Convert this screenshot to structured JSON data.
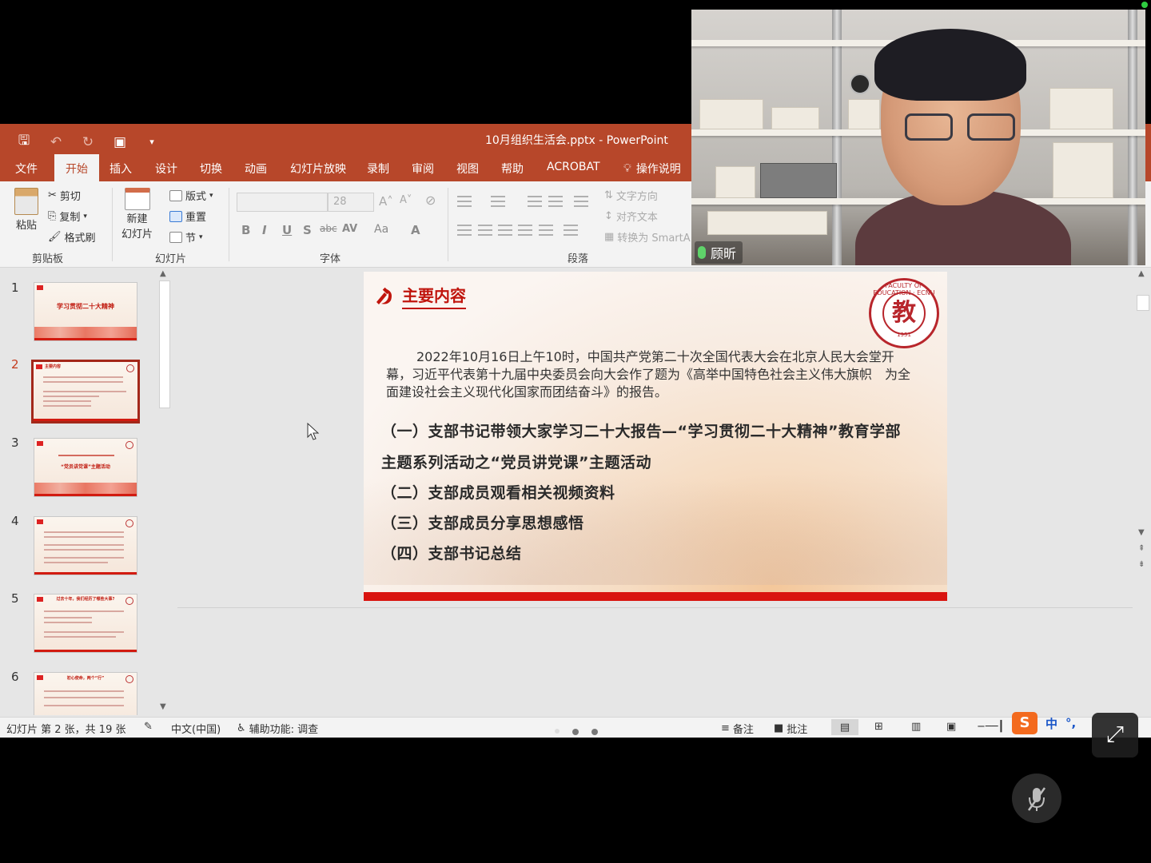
{
  "window": {
    "title": "10月组织生活会.pptx  -  PowerPoint"
  },
  "tabs": [
    "文件",
    "开始",
    "插入",
    "设计",
    "切换",
    "动画",
    "幻灯片放映",
    "录制",
    "审阅",
    "视图",
    "帮助",
    "ACROBAT",
    "操作说明"
  ],
  "ribbon": {
    "clipboard": {
      "paste": "粘贴",
      "cut": "剪切",
      "copy": "复制",
      "format_painter": "格式刷",
      "label": "剪贴板"
    },
    "slides": {
      "new_slide_line1": "新建",
      "new_slide_line2": "幻灯片",
      "layout": "版式",
      "reset": "重置",
      "section": "节",
      "label": "幻灯片"
    },
    "font": {
      "size": "28",
      "bold": "B",
      "italic": "I",
      "underline": "U",
      "shadow": "S",
      "strike": "abc",
      "spacing": "AV",
      "case": "Aa",
      "color": "A",
      "label": "字体"
    },
    "paragraph": {
      "text_direction": "文字方向",
      "align_text": "对齐文本",
      "convert_smartart": "转换为 SmartA",
      "label": "段落"
    }
  },
  "thumbnails": [
    {
      "num": "1",
      "title": "学习贯彻二十大精神",
      "selected": false
    },
    {
      "num": "2",
      "title": "主要内容",
      "selected": true
    },
    {
      "num": "3",
      "title": "“党员讲党课”主题活动",
      "selected": false
    },
    {
      "num": "4",
      "title": "",
      "selected": false
    },
    {
      "num": "5",
      "title": "过去十年，我们经历了哪些大事?",
      "selected": false
    },
    {
      "num": "6",
      "title": "初心使命，两个“行”",
      "selected": false
    }
  ],
  "slide": {
    "heading": "主要内容",
    "seal_text": "FACULTY OF EDUCATION · ECNU",
    "seal_glyph": "教",
    "seal_year": "1951",
    "paragraph": "2022年10月16日上午10时，中国共产党第二十次全国代表大会在北京人民大会堂开幕，习近平代表第十九届中央委员会向大会作了题为《高举中国特色社会主义伟大旗帜　为全面建设社会主义现代化国家而团结奋斗》的报告。",
    "items": [
      "（一）支部书记带领大家学习二十大报告—“学习贯彻二十大精神”教育学部",
      "主题系列活动之“党员讲党课”主题活动",
      "（二）支部成员观看相关视频资料",
      "（三）支部成员分享思想感悟",
      "（四）支部书记总结"
    ]
  },
  "status": {
    "slide_count": "幻灯片 第 2 张，共 19 张",
    "language": "中文(中国)",
    "accessibility": "辅助功能: 调查",
    "notes": "备注",
    "comments": "批注"
  },
  "video": {
    "participant_name": "顾昕"
  },
  "ime": {
    "s_label": "S",
    "mode": "中"
  },
  "colors": {
    "ppt_red": "#b7472a",
    "slide_red": "#d9140f"
  }
}
